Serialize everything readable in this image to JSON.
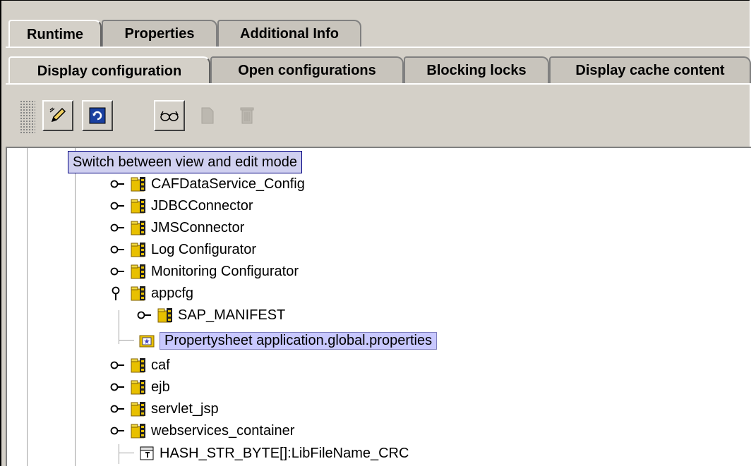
{
  "tabs_primary": [
    {
      "label": "Runtime",
      "active": true
    },
    {
      "label": "Properties",
      "active": false
    },
    {
      "label": "Additional Info",
      "active": false
    }
  ],
  "tabs_secondary": [
    {
      "label": "Display configuration",
      "active": true
    },
    {
      "label": "Open configurations",
      "active": false
    },
    {
      "label": "Blocking locks",
      "active": false
    },
    {
      "label": "Display cache content",
      "active": false
    }
  ],
  "toolbar": {
    "buttons": [
      {
        "icon": "pencil-icon",
        "enabled": true
      },
      {
        "icon": "refresh-icon",
        "enabled": true
      },
      {
        "icon": "glasses-icon",
        "enabled": true
      },
      {
        "icon": "page-icon",
        "enabled": false
      },
      {
        "icon": "trash-icon",
        "enabled": false
      }
    ]
  },
  "tooltip": "Switch between view and edit mode",
  "tree": {
    "items": [
      {
        "label": "CAFDataService_Config",
        "type": "folder",
        "expanded": false
      },
      {
        "label": "JDBCConnector",
        "type": "folder",
        "expanded": false
      },
      {
        "label": "JMSConnector",
        "type": "folder",
        "expanded": false
      },
      {
        "label": "Log Configurator",
        "type": "folder",
        "expanded": false
      },
      {
        "label": "Monitoring Configurator",
        "type": "folder",
        "expanded": false
      },
      {
        "label": "appcfg",
        "type": "folder",
        "expanded": true
      },
      {
        "label": "SAP_MANIFEST",
        "type": "folder",
        "expanded": false
      },
      {
        "label": "Propertysheet application.global.properties",
        "type": "propertysheet",
        "selected": true
      },
      {
        "label": "caf",
        "type": "folder",
        "expanded": false
      },
      {
        "label": "ejb",
        "type": "folder",
        "expanded": false
      },
      {
        "label": "servlet_jsp",
        "type": "folder",
        "expanded": false
      },
      {
        "label": "webservices_container",
        "type": "folder",
        "expanded": false
      },
      {
        "label": "HASH_STR_BYTE[]:LibFileName_CRC",
        "type": "entry"
      }
    ]
  },
  "colors": {
    "background": "#d4d0c8",
    "selection": "#c8c8ff",
    "tooltip": "#d0d0f0",
    "folder": "#e8c000"
  }
}
